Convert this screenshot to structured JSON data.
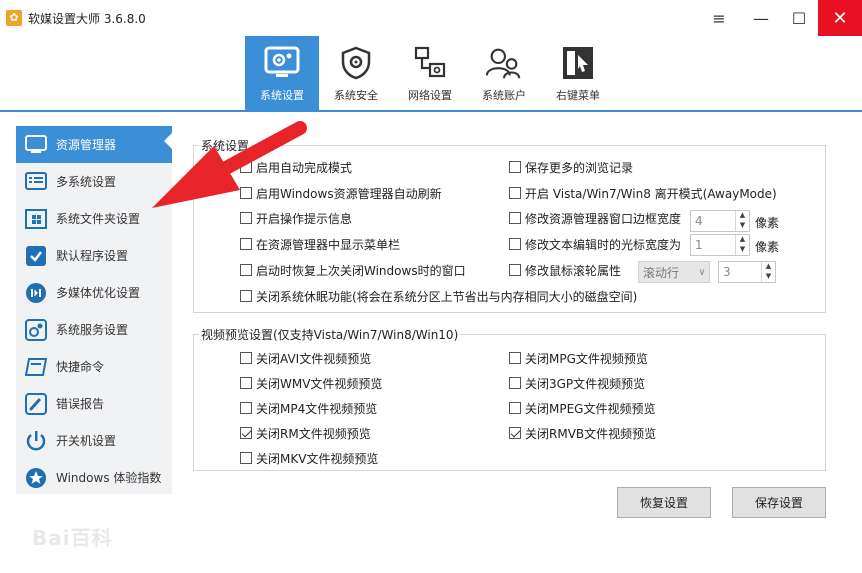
{
  "window": {
    "title": "软媒设置大师 3.6.8.0",
    "menu_icon": "≡",
    "minimize_icon": "—",
    "maximize_icon": "☐",
    "close_icon": "✕"
  },
  "toolbar": {
    "tabs": [
      {
        "label": "系统设置",
        "icon": "gear-monitor-icon",
        "active": true
      },
      {
        "label": "系统安全",
        "icon": "shield-icon",
        "active": false
      },
      {
        "label": "网络设置",
        "icon": "network-icon",
        "active": false
      },
      {
        "label": "系统账户",
        "icon": "users-icon",
        "active": false
      },
      {
        "label": "右键菜单",
        "icon": "context-menu-icon",
        "active": false
      }
    ]
  },
  "sidebar": {
    "items": [
      {
        "label": "资源管理器",
        "icon": "explorer-icon",
        "active": true
      },
      {
        "label": "多系统设置",
        "icon": "multi-system-icon",
        "active": false
      },
      {
        "label": "系统文件夹设置",
        "icon": "folder-icon",
        "active": false
      },
      {
        "label": "默认程序设置",
        "icon": "default-program-icon",
        "active": false
      },
      {
        "label": "多媒体优化设置",
        "icon": "multimedia-icon",
        "active": false
      },
      {
        "label": "系统服务设置",
        "icon": "service-icon",
        "active": false
      },
      {
        "label": "快捷命令",
        "icon": "shortcut-icon",
        "active": false
      },
      {
        "label": "错误报告",
        "icon": "error-report-icon",
        "active": false
      },
      {
        "label": "开关机设置",
        "icon": "power-icon",
        "active": false
      },
      {
        "label": "Windows 体验指数",
        "icon": "experience-icon",
        "active": false
      }
    ]
  },
  "system_settings": {
    "title": "系统设置",
    "left_options": [
      {
        "label": "启用自动完成模式",
        "checked": false
      },
      {
        "label": "启用Windows资源管理器自动刷新",
        "checked": false
      },
      {
        "label": "开启操作提示信息",
        "checked": false
      },
      {
        "label": "在资源管理器中显示菜单栏",
        "checked": false
      },
      {
        "label": "启动时恢复上次关闭Windows时的窗口",
        "checked": false
      },
      {
        "label": "关闭系统休眠功能(将会在系统分区上节省出与内存相同大小的磁盘空间)",
        "checked": false
      }
    ],
    "right_options": [
      {
        "label": "保存更多的浏览记录",
        "checked": false
      },
      {
        "label": "开启 Vista/Win7/Win8 离开模式(AwayMode)",
        "checked": false
      },
      {
        "label": "修改资源管理器窗口边框宽度",
        "checked": false
      },
      {
        "label": "修改文本编辑时的光标宽度为",
        "checked": false
      },
      {
        "label": "修改鼠标滚轮属性",
        "checked": false
      }
    ],
    "border_width": {
      "value": "4",
      "unit": "像素"
    },
    "cursor_width": {
      "value": "1",
      "unit": "像素"
    },
    "wheel_mode": {
      "value": "滚动行"
    },
    "wheel_lines": {
      "value": "3"
    }
  },
  "video_preview": {
    "title": "视频预览设置(仅支持Vista/Win7/Win8/Win10)",
    "left_options": [
      {
        "label": "关闭AVI文件视频预览",
        "checked": false
      },
      {
        "label": "关闭WMV文件视频预览",
        "checked": false
      },
      {
        "label": "关闭MP4文件视频预览",
        "checked": false
      },
      {
        "label": "关闭RM文件视频预览",
        "checked": true
      },
      {
        "label": "关闭MKV文件视频预览",
        "checked": false
      }
    ],
    "right_options": [
      {
        "label": "关闭MPG文件视频预览",
        "checked": false
      },
      {
        "label": "关闭3GP文件视频预览",
        "checked": false
      },
      {
        "label": "关闭MPEG文件视频预览",
        "checked": false
      },
      {
        "label": "关闭RMVB文件视频预览",
        "checked": true
      }
    ]
  },
  "buttons": {
    "restore": "恢复设置",
    "save": "保存设置"
  },
  "watermark": "Bai百科",
  "colors": {
    "accent": "#3a8fd6",
    "close": "#e81123",
    "arrow": "#e8242b"
  }
}
